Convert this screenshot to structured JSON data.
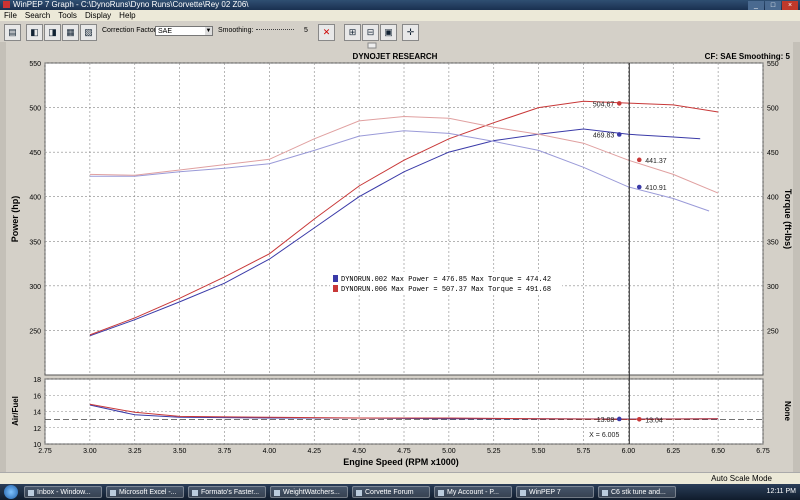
{
  "window": {
    "title": "WinPEP 7   Graph - C:\\DynoRuns\\Dyno Runs\\Corvette\\Rey 02 Z06\\",
    "min": "_",
    "max": "□",
    "close": "×"
  },
  "menu": [
    "File",
    "Search",
    "Tools",
    "Display",
    "Help"
  ],
  "toolbar": {
    "correction_label": "Correction Factor:",
    "correction_value": "SAE",
    "smoothing_label": "Smoothing:",
    "smoothing_value": "5"
  },
  "graph": {
    "title": "DYNOJET RESEARCH",
    "info": "CF: SAE  Smoothing: 5",
    "cursor_x_label": "X = 6.005"
  },
  "colors": {
    "run002": "#3a3aa8",
    "run006": "#c83838",
    "run002_light": "#9a9ad8",
    "run006_light": "#e0a0a0"
  },
  "chart_data": [
    {
      "type": "line",
      "xlabel": "Engine Speed (RPM x1000)",
      "ylabel": "Power (hp)",
      "y2label": "Torque (ft-lbs)",
      "xlim": [
        2.75,
        6.75
      ],
      "ylim": [
        200,
        550
      ],
      "y2lim": [
        200,
        550
      ],
      "xticks": [
        "2.75",
        "3.00",
        "3.25",
        "3.50",
        "3.75",
        "4.00",
        "4.25",
        "4.50",
        "4.75",
        "5.00",
        "5.25",
        "5.50",
        "5.75",
        "6.00",
        "6.25",
        "6.50",
        "6.75"
      ],
      "yticks": [
        "250",
        "300",
        "350",
        "400",
        "450",
        "500",
        "550"
      ],
      "grid": true,
      "legend": [
        {
          "swatch": "#3a3aa8",
          "text": "DYNORUN.002 Max Power = 476.85 Max Torque = 474.42"
        },
        {
          "swatch": "#c83838",
          "text": "DYNORUN.006 Max Power = 507.37 Max Torque = 491.68"
        }
      ],
      "series": [
        {
          "name": "DYNORUN.002",
          "kind": "power",
          "color": "#3a3aa8",
          "x": [
            3.0,
            3.25,
            3.5,
            3.75,
            4.0,
            4.25,
            4.5,
            4.75,
            5.0,
            5.25,
            5.5,
            5.75,
            6.0,
            6.25,
            6.4
          ],
          "y": [
            244,
            262,
            282,
            303,
            330,
            365,
            400,
            428,
            450,
            463,
            470,
            476,
            470,
            467,
            465
          ]
        },
        {
          "name": "DYNORUN.006",
          "kind": "power",
          "color": "#c83838",
          "x": [
            3.0,
            3.25,
            3.5,
            3.75,
            4.0,
            4.25,
            4.5,
            4.75,
            5.0,
            5.25,
            5.5,
            5.75,
            6.0,
            6.25,
            6.5
          ],
          "y": [
            245,
            264,
            286,
            310,
            336,
            375,
            412,
            441,
            465,
            483,
            500,
            507,
            505,
            503,
            495
          ]
        },
        {
          "name": "DYNORUN.002",
          "kind": "torque",
          "color": "#9a9ad8",
          "x": [
            3.0,
            3.25,
            3.5,
            3.75,
            4.0,
            4.25,
            4.5,
            4.75,
            5.0,
            5.25,
            5.5,
            5.75,
            6.0,
            6.25,
            6.45
          ],
          "y": [
            423,
            423,
            428,
            432,
            437,
            452,
            468,
            474,
            471,
            462,
            452,
            433,
            411,
            398,
            384
          ]
        },
        {
          "name": "DYNORUN.006",
          "kind": "torque",
          "color": "#e0a0a0",
          "x": [
            3.0,
            3.25,
            3.5,
            3.75,
            4.0,
            4.25,
            4.5,
            4.75,
            5.0,
            5.25,
            5.5,
            5.75,
            6.0,
            6.25,
            6.5
          ],
          "y": [
            425,
            424,
            430,
            436,
            442,
            465,
            485,
            490,
            488,
            478,
            470,
            460,
            441,
            425,
            404
          ]
        }
      ],
      "cursor_x": 6.005,
      "cursor_labels": [
        {
          "y": 504.67,
          "text": "504.67",
          "color": "#c83838",
          "side": "left"
        },
        {
          "y": 469.83,
          "text": "469.83",
          "color": "#3a3aa8",
          "side": "left"
        },
        {
          "y": 441.37,
          "text": "441.37",
          "color": "#c83838",
          "side": "right"
        },
        {
          "y": 410.91,
          "text": "410.91",
          "color": "#3a3aa8",
          "side": "right"
        }
      ]
    },
    {
      "type": "line",
      "ylabel": "Air/Fuel",
      "y2label": "None",
      "xlim": [
        2.75,
        6.75
      ],
      "ylim": [
        10,
        18
      ],
      "yticks": [
        "10",
        "12",
        "14",
        "16",
        "18"
      ],
      "grid": true,
      "series": [
        {
          "name": "DYNORUN.002",
          "color": "#3a3aa8",
          "x": [
            3.0,
            3.25,
            3.5,
            4.0,
            4.5,
            5.0,
            5.5,
            6.0,
            6.5
          ],
          "y": [
            14.8,
            13.6,
            13.3,
            13.2,
            13.2,
            13.1,
            13.1,
            13.08,
            13.1
          ]
        },
        {
          "name": "DYNORUN.006",
          "color": "#c83838",
          "x": [
            3.0,
            3.25,
            3.5,
            4.0,
            4.5,
            5.0,
            5.5,
            6.0,
            6.5
          ],
          "y": [
            14.9,
            13.9,
            13.4,
            13.3,
            13.2,
            13.2,
            13.1,
            13.04,
            13.1
          ]
        }
      ],
      "cursor_labels": [
        {
          "y": 13.08,
          "text": "13.08",
          "color": "#3a3aa8",
          "side": "left"
        },
        {
          "y": 13.04,
          "text": "13.04",
          "color": "#c83838",
          "side": "right"
        }
      ]
    }
  ],
  "status": {
    "mode": "Auto Scale Mode"
  },
  "taskbar": {
    "items": [
      "Inbox - Window...",
      "Microsoft Excel -...",
      "Formato's Faster...",
      "WeightWatchers...",
      "Corvette Forum",
      "My Account - P...",
      "WinPEP 7",
      "C6 stk tune and..."
    ],
    "clock": "12:11 PM"
  }
}
